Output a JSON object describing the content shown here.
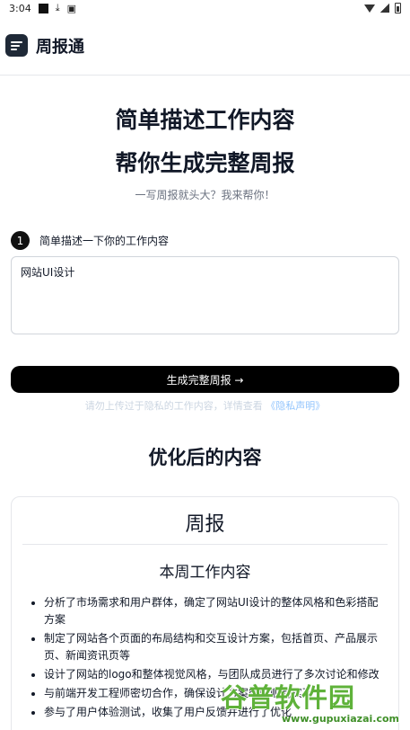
{
  "status_bar": {
    "time": "3:04"
  },
  "app_bar": {
    "title": "周报通",
    "logo_icon": "menu-lines-icon"
  },
  "hero": {
    "line1": "简单描述工作内容",
    "line2": "帮你生成完整周报",
    "subtitle": "一写周报就头大？我来帮你！"
  },
  "step": {
    "number": "1",
    "label": "简单描述一下你的工作内容"
  },
  "input": {
    "value": "网站UI设计"
  },
  "generate_button": {
    "label": "生成完整周报 →"
  },
  "privacy": {
    "text": "请勿上传过于隐私的工作内容，详情查看",
    "link": "《隐私声明》"
  },
  "result": {
    "section_title": "优化后的内容",
    "heading": "周报",
    "subheading": "本周工作内容",
    "items": [
      "分析了市场需求和用户群体，确定了网站UI设计的整体风格和色彩搭配方案",
      "制定了网站各个页面的布局结构和交互设计方案，包括首页、产品展示页、新闻资讯页等",
      "设计了网站的logo和整体视觉风格，与团队成员进行了多次讨论和修改",
      "与前端开发工程师密切合作，确保设计方案能够顺利实现",
      "参与了用户体验测试，收集了用户反馈并进行了优化"
    ]
  },
  "watermark": {
    "main": "谷普软件园",
    "url": "www.gupuxiazai.com"
  }
}
